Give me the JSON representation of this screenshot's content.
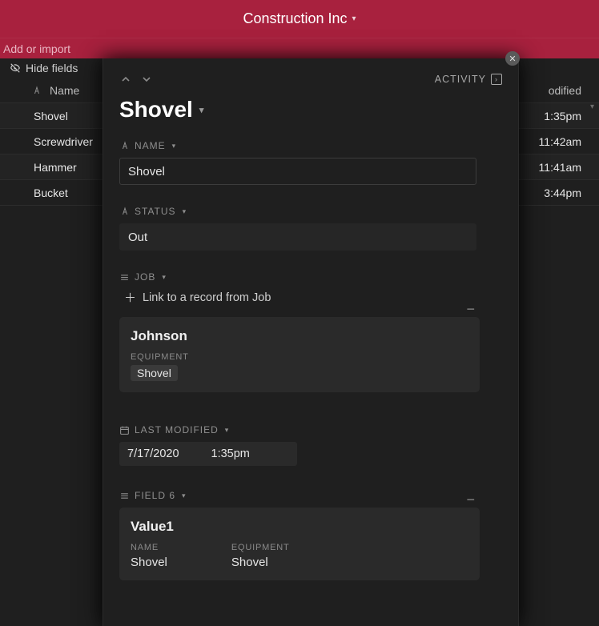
{
  "header": {
    "title": "Construction Inc"
  },
  "addbar": {
    "label": "Add or import"
  },
  "toolbar": {
    "hide_fields": "Hide fields"
  },
  "table": {
    "columns": {
      "name": "Name",
      "modified": "odified"
    },
    "rows": [
      {
        "name": "Shovel",
        "time": "1:35pm"
      },
      {
        "name": "Screwdriver",
        "time": "11:42am"
      },
      {
        "name": "Hammer",
        "time": "11:41am"
      },
      {
        "name": "Bucket",
        "time": "3:44pm"
      }
    ]
  },
  "panel": {
    "activity_label": "ACTIVITY",
    "title": "Shovel",
    "fields": {
      "name": {
        "label": "NAME",
        "value": "Shovel"
      },
      "status": {
        "label": "STATUS",
        "value": "Out"
      },
      "job": {
        "label": "JOB",
        "link_text": "Link to a record from Job",
        "card": {
          "title": "Johnson",
          "sub_label": "EQUIPMENT",
          "chip": "Shovel"
        }
      },
      "last_modified": {
        "label": "LAST MODIFIED",
        "date": "7/17/2020",
        "time": "1:35pm"
      },
      "field6": {
        "label": "FIELD 6",
        "card": {
          "title": "Value1",
          "cols": [
            {
              "label": "NAME",
              "value": "Shovel"
            },
            {
              "label": "EQUIPMENT",
              "value": "Shovel"
            }
          ]
        }
      }
    }
  }
}
